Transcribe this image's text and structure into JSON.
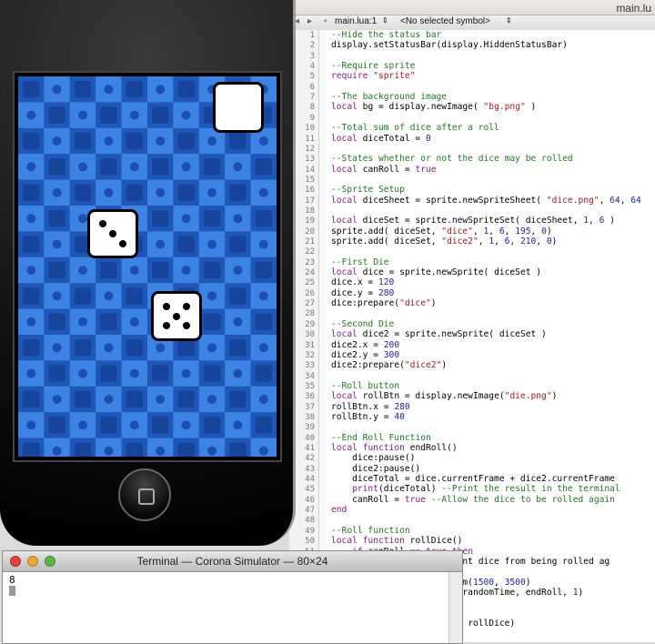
{
  "editor": {
    "window_title": "main.lu",
    "nav": {
      "file": "main.lua:1",
      "symbol": "<No selected symbol>"
    },
    "lines": [
      "--Hide the status bar",
      "display.setStatusBar(display.HiddenStatusBar)",
      "",
      "--Require sprite",
      "require \"sprite\"",
      "",
      "--The background image",
      "local bg = display.newImage( \"bg.png\" )",
      "",
      "--Total sum of dice after a roll",
      "local diceTotal = 0",
      "",
      "--States whether or not the dice may be rolled",
      "local canRoll = true",
      "",
      "--Sprite Setup",
      "local diceSheet = sprite.newSpriteSheet( \"dice.png\", 64, 64",
      "",
      "local diceSet = sprite.newSpriteSet( diceSheet, 1, 6 )",
      "sprite.add( diceSet, \"dice\", 1, 6, 195, 0)",
      "sprite.add( diceSet, \"dice2\", 1, 6, 210, 0)",
      "",
      "--First Die",
      "local dice = sprite.newSprite( diceSet )",
      "dice.x = 120",
      "dice.y = 280",
      "dice:prepare(\"dice\")",
      "",
      "--Second Die",
      "local dice2 = sprite.newSprite( diceSet )",
      "dice2.x = 200",
      "dice2.y = 300",
      "dice2:prepare(\"dice2\")",
      "",
      "--Roll button",
      "local rollBtn = display.newImage(\"die.png\")",
      "rollBtn.x = 280",
      "rollBtn.y = 40",
      "",
      "--End Roll Function",
      "local function endRoll()",
      "    dice:pause()",
      "    dice2:pause()",
      "    diceTotal = dice.currentFrame + dice2.currentFrame",
      "    print(diceTotal) --Print the result in the terminal",
      "    canRoll = true --Allow the dice to be rolled again",
      "end",
      "",
      "--Roll function",
      "local function rollDice()",
      "    if canRoll == true then",
      "                   -Prevent dice from being rolled ag",
      "",
      "                   .random(1500, 3500)",
      "                   Delay(randomTime, endRoll, 1)",
      "",
      "",
      "                   \"tap\", rollDice)"
    ]
  },
  "simulator": {
    "die1_face": 3,
    "die2_face": 5,
    "roll_button_face": 1
  },
  "terminal": {
    "title": "Terminal — Corona Simulator — 80×24",
    "output": "8"
  },
  "colors": {
    "comment": "#1f7a1f",
    "keyword": "#8b1a8b",
    "string": "#b0171c",
    "number": "#1c21b6",
    "background_blue": "#2a6fd8"
  },
  "icons": [
    "close-icon",
    "minimize-icon",
    "zoom-icon",
    "home-button-icon"
  ]
}
